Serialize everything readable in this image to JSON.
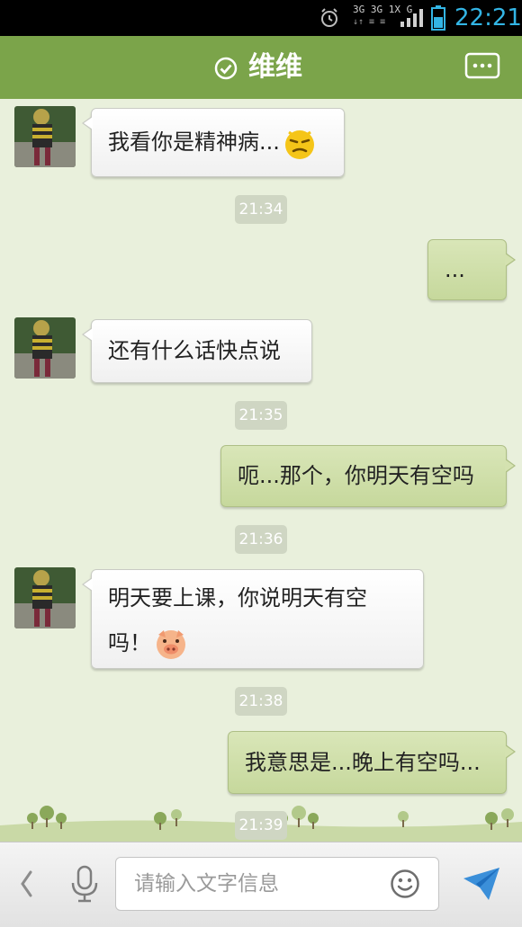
{
  "status_bar": {
    "network_top": "3G 3G 1X G",
    "network_bottom": "↓↑ ≡ ≡",
    "time": "22:21",
    "accent_color": "#33b5e5"
  },
  "header": {
    "title": "维维",
    "status_icon": "check-circle-icon",
    "menu_icon": "more-options-icon",
    "color": "#7ba44a"
  },
  "messages": [
    {
      "side": "left",
      "text": "我看你是精神病...",
      "emoji": "smug-face-emoji"
    },
    {
      "type": "time",
      "text": "21:34"
    },
    {
      "side": "right",
      "text": "..."
    },
    {
      "side": "left",
      "text": "还有什么话快点说"
    },
    {
      "type": "time",
      "text": "21:35"
    },
    {
      "side": "right",
      "text": "呃...那个，你明天有空吗"
    },
    {
      "type": "time",
      "text": "21:36"
    },
    {
      "side": "left",
      "line1": "明天要上课，你说明天有空",
      "line2": "吗！",
      "emoji": "pig-face-emoji"
    },
    {
      "type": "time",
      "text": "21:38"
    },
    {
      "side": "right",
      "text": "我意思是...晚上有空吗..."
    },
    {
      "type": "time",
      "text": "21:39"
    }
  ],
  "input_bar": {
    "placeholder": "请输入文字信息",
    "value": "",
    "left_icon": "back-arrow-icon",
    "voice_icon": "microphone-icon",
    "emoji_icon": "smiley-icon",
    "send_icon": "send-icon"
  }
}
